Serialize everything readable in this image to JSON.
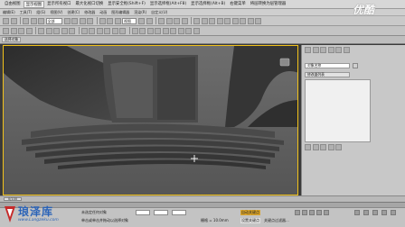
{
  "tabs": [
    "自由视图",
    "显示视图",
    "显示所有视口",
    "最大化视口切换",
    "显示安全框(Shift+F)",
    "显示选择框(Alt+F8)",
    "显示选择框(Alt+B)",
    "右键菜单",
    "将层转换为层管理器",
    "渲染设置",
    "切换层"
  ],
  "menus": [
    "编辑(E)",
    "工具(T)",
    "组(G)",
    "视图(V)",
    "创建(C)",
    "修改器",
    "动画",
    "图形编辑器",
    "渲染(R)",
    "自定义(U)",
    "MAXScript(X)",
    "帮助(H)"
  ],
  "toolbar": {
    "combo_all": "全部",
    "combo_view": "视图"
  },
  "subbar": {
    "label": "选择对象"
  },
  "viewport": {
    "label": "[+] [透视] [真实]"
  },
  "cmdpanel": {
    "name_field": "对象名称",
    "list_label": "修改器列表"
  },
  "timeline": {
    "frame_start": "0",
    "frame_end": "100"
  },
  "status": {
    "selection": "未选定任何对象",
    "hint": "单击或单击并拖动以选择对象",
    "grid": "栅格 = 10.0mm",
    "auto_key": "自动关键点",
    "set_key": "设置关键点",
    "filter": "关键点过滤器..."
  },
  "logo": {
    "title": "琅泽库",
    "subtitle": "www.Langzeku.com"
  },
  "watermark": {
    "text": "优酷"
  },
  "colors": {
    "accent": "#f2c21a",
    "brand": "#2a63b8"
  }
}
